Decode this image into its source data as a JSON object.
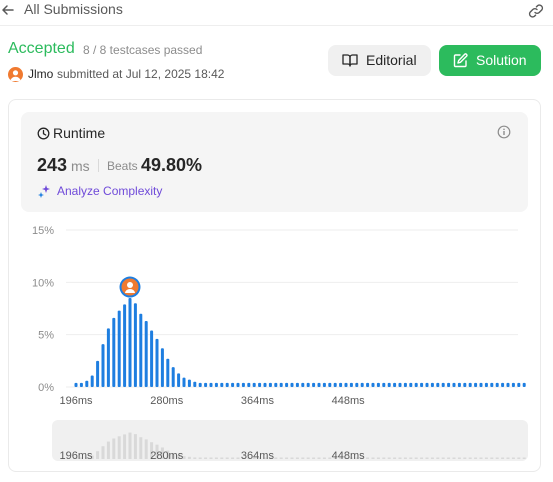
{
  "nav": {
    "back_label": "All Submissions",
    "back_icon": "arrow-left-icon",
    "share_icon": "link-icon"
  },
  "submission": {
    "status": "Accepted",
    "testcases": "8 / 8 testcases passed",
    "user": "Jlmo",
    "submitted_text": "submitted at Jul 12, 2025 18:42"
  },
  "buttons": {
    "editorial": "Editorial",
    "solution": "Solution"
  },
  "runtime": {
    "title": "Runtime",
    "value": "243",
    "unit": "ms",
    "beats_label": "Beats",
    "beats_value": "49.80%",
    "analyze_label": "Analyze Complexity"
  },
  "colors": {
    "accepted": "#2cbb5d",
    "bar": "#1e7ee0",
    "analyze": "#6f4ad9",
    "avatar": "#f07a30"
  },
  "chart_data": {
    "type": "bar",
    "xlabel": "",
    "ylabel": "",
    "y_ticks": [
      "15%",
      "10%",
      "5%",
      "0%"
    ],
    "ylim": [
      0,
      15
    ],
    "x_tick_labels": [
      "196ms",
      "280ms",
      "364ms",
      "448ms"
    ],
    "x_tick_values": [
      196,
      280,
      364,
      448
    ],
    "x_start": 196,
    "x_step": 5,
    "values": [
      0.4,
      0.4,
      0.6,
      1.1,
      2.5,
      4.1,
      5.6,
      6.6,
      7.3,
      7.9,
      8.5,
      8.0,
      7.0,
      6.3,
      5.4,
      4.6,
      3.7,
      2.7,
      1.9,
      1.3,
      0.9,
      0.7,
      0.5,
      0.4,
      0.4,
      0.4,
      0.4,
      0.4,
      0.4,
      0.4,
      0.4,
      0.4,
      0.4,
      0.4,
      0.4,
      0.4,
      0.4,
      0.4,
      0.4,
      0.4,
      0.4,
      0.4,
      0.4,
      0.4,
      0.4,
      0.4,
      0.4,
      0.4,
      0.4,
      0.4,
      0.4,
      0.4,
      0.4,
      0.4,
      0.4,
      0.4,
      0.4,
      0.4,
      0.4,
      0.4,
      0.4,
      0.4,
      0.4,
      0.4,
      0.4,
      0.4,
      0.4,
      0.4,
      0.4,
      0.4,
      0.4,
      0.4,
      0.4,
      0.4,
      0.4,
      0.4,
      0.4,
      0.4,
      0.4,
      0.4,
      0.4,
      0.4,
      0.4,
      0.4
    ],
    "user_bar_index": 10,
    "grid": true,
    "legend": "none"
  }
}
